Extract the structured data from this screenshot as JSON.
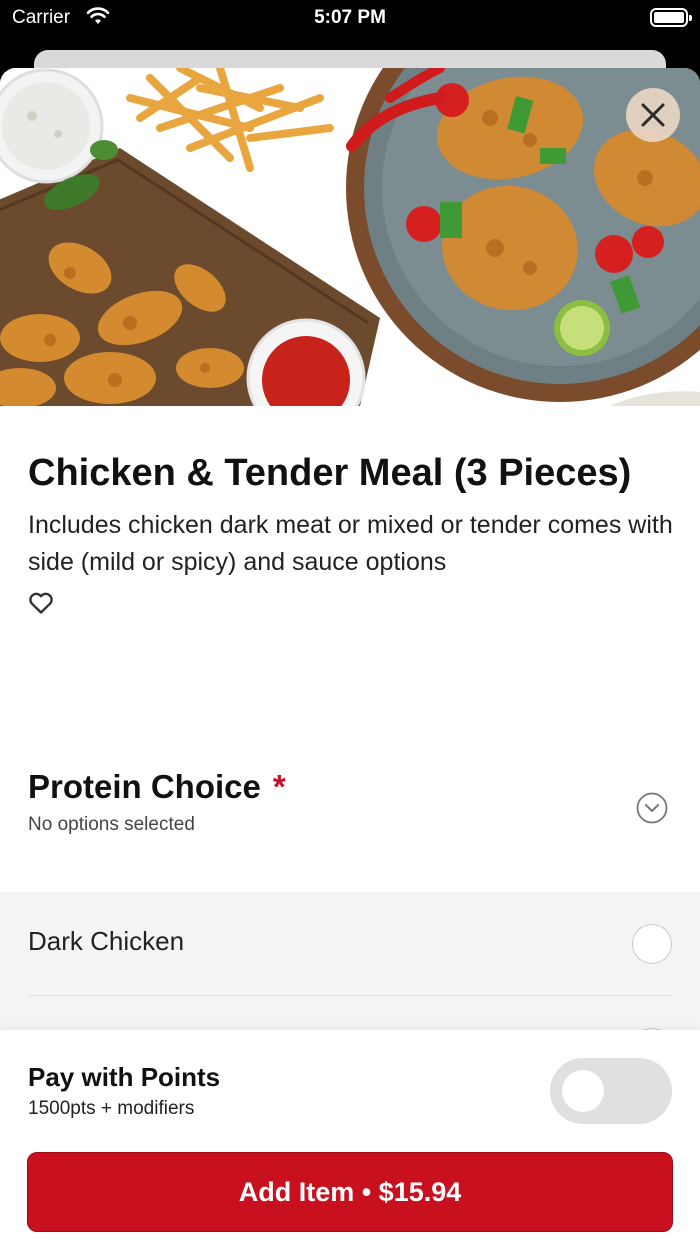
{
  "status_bar": {
    "carrier": "Carrier",
    "time": "5:07 PM"
  },
  "item": {
    "title": "Chicken & Tender Meal (3 Pieces)",
    "description": "Includes chicken dark meat or mixed or tender comes with side (mild or spicy) and sauce options"
  },
  "modifier_group": {
    "title": "Protein Choice",
    "required_marker": "*",
    "status": "No options selected",
    "options": [
      {
        "label": "Dark Chicken",
        "selected": false
      }
    ]
  },
  "footer": {
    "points_title": "Pay with Points",
    "points_sub": "1500pts + modifiers",
    "points_enabled": false,
    "add_button": "Add Item • $15.94"
  },
  "colors": {
    "accent": "#c8101e",
    "required": "#c8102e"
  },
  "icons": [
    "wifi-icon",
    "battery-icon",
    "close-icon",
    "heart-icon",
    "chevron-down-icon"
  ]
}
